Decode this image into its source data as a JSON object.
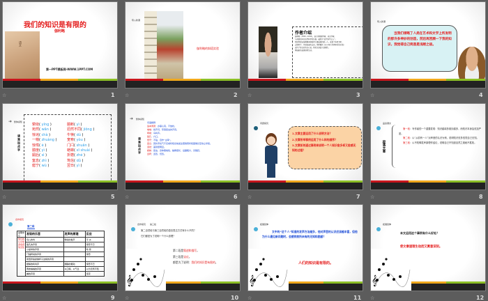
{
  "slides": [
    {
      "number": "1",
      "title": "我们的知识是有限的",
      "subtitle": "伽利略",
      "footer": "第一PPT模板网-WWW.1PPT.COM",
      "book_label": "语文"
    },
    {
      "number": "2",
      "tag": "导入新课",
      "caption": "伽利略的斜塔实验"
    },
    {
      "number": "3",
      "heading": "作者介绍",
      "lines": [
        "伽利略（1564－1642），意大利物理学家、天文学家，",
        "与普朗克同为近代科学的先驱，被誉为“近代科学之父”。",
        "他是用望远镜观察天体取得大量成果的第一人，发现了木星卫星、",
        "太阳黑子、月球表面的山谷，他所著的《关于两大世界体系的对话》",
        "支持了哥白尼的日心说，他的文章富于逻辑性，",
        "将抽象的道理讲得生动。"
      ]
    },
    {
      "number": "4",
      "tag": "导入新课",
      "bubble": "当我们领略了人类在艺术和文学上所发明的那许多神妙的创造，然后再回顾一下我的知识，我觉得自己简直是浅陋之极。"
    },
    {
      "number": "5",
      "tag": "整体感知",
      "side": "读准加点字",
      "left": [
        [
          "萦绕",
          "yíng"
        ],
        [
          "宛然",
          "wǎn"
        ],
        [
          "惊诧",
          "chà"
        ],
        [
          "一幢",
          "zhuàng"
        ],
        [
          "惊愕",
          "è"
        ],
        [
          "臆度",
          "yì"
        ],
        [
          "嗣后",
          "sì"
        ],
        [
          "窒息",
          "zhì"
        ],
        [
          "寤宁",
          "wù"
        ]
      ],
      "right": [
        [
          "臆断",
          "yì"
        ],
        [
          "迥然不同",
          "jiǒng"
        ],
        [
          "牛犊",
          "dú"
        ],
        [
          "宽宥",
          "yòu"
        ],
        [
          "门闩",
          "shuān"
        ],
        [
          "蟋蟀",
          "xī shuài"
        ],
        [
          "折磨",
          "zhé"
        ],
        [
          "笃信",
          "dǔ"
        ],
        [
          "翌日",
          "yì"
        ]
      ]
    },
    {
      "number": "6",
      "tag": "整体感知",
      "side": "读准加点字",
      "head": "词语解释",
      "items": [
        [
          "追本溯源",
          "：办事认真，不放松。"
        ],
        [
          "嗡嗡",
          "：拟声词，形容昆虫的声音。"
        ],
        [
          "啁啾",
          "：鸟鸣声。"
        ],
        [
          "笛孔",
          "：穴口。"
        ],
        [
          "悟守",
          "：不贴，自作“主宰”。"
        ],
        [
          "窒息",
          "：因外界氧气不足或呼吸系统发生障碍而呼吸困难甚至停止呼吸。"
        ],
        [
          "迥然",
          "：差别很明显。"
        ],
        [
          "蟋蟀",
          "：昆虫，身体黑褐色，触角很长，后腿粗大，善跳跃。"
        ],
        [
          "宽宥",
          "：宽恕，饶恕。"
        ]
      ]
    },
    {
      "number": "7",
      "tag": "问题探究",
      "questions": [
        "1.文章主要运用了什么说明方法？",
        "2.文章所举事例运用了什么样的顺序？",
        "3.文章如何通过事例来说明一个人知识愈多却又愈感无知的过程？"
      ]
    },
    {
      "number": "8",
      "tag": "品读课文",
      "side": "段落大意",
      "paras": [
        [
          "第一段",
          "：写作者的一个重要发现：知识越增多奥妙越多，而知识本身会愈加严密。"
        ],
        [
          "第二段",
          "：以“从前有一人”对声音的认识为例，说明知识愈多愈觉自己无知。"
        ],
        [
          "第三段",
          "：以不知蝉发声原理作结论，说明自己不知道自然之奥秘不胜枚。"
        ]
      ]
    },
    {
      "number": "9",
      "tag": "合作探究",
      "sub": "第二段",
      "headers": [
        "说明中心",
        "发现的乐音",
        "发声的原理",
        "反应"
      ],
      "center": "他们的认识愈多愈感到无知",
      "rows": [
        [
          "鸟儿的叫",
          "喉咙的发声",
          "平 淡"
        ],
        [
          "笛孔的声音",
          "",
          "惊奇不已"
        ],
        [
          "小提琴的声音",
          "",
          "吃 惊"
        ],
        [
          "门轴转动的声音",
          "",
          "惊奇"
        ],
        [
          "用湿手指摩擦杯子边缘的声音",
          "",
          ""
        ],
        [
          "蟋蟀的鸣叫声",
          "翅膀的振动",
          "惊奇不已"
        ],
        [
          "黄蜂嗡嗡的声音",
          "以口唱、以气息",
          "以为无所不知"
        ],
        [
          "蝉的声音",
          "",
          "坚定"
        ]
      ]
    },
    {
      "number": "10",
      "tag": "合作探究",
      "tag2": "第三段",
      "q": [
        "第二自然段与第三自然段的语言表达方式有什么不同？",
        "它们都是为了说明一个什么道理？"
      ],
      "a": [
        [
          "第二段是",
          "叙述和描写",
          "，"
        ],
        [
          "第三段是",
          "议论",
          "，"
        ],
        [
          "都是为了说明：",
          "我们的知识是有限的",
          "。"
        ]
      ]
    },
    {
      "number": "11",
      "tag": "拓展延伸",
      "text": "文中的“这个人”知道的发声方法越多，他对声音的认识应该越丰富，但他为什么遇见新问题时，会感到前所未有的无知和困惑？",
      "answer": "人们的知识是有限的。"
    },
    {
      "number": "12",
      "tag": "拓展延伸",
      "q": "本文运用这个事例有什么好处？",
      "answer": "使文章道理生动而又寓意深刻。"
    }
  ]
}
